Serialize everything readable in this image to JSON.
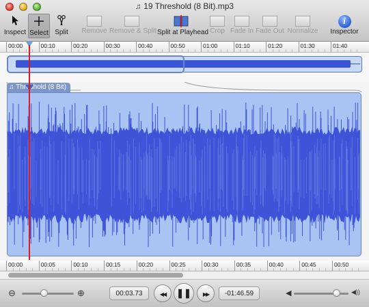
{
  "window": {
    "title": "19 Threshold (8 Bit).mp3",
    "doc_icon": "music-document-icon"
  },
  "toolbar": {
    "inspect": "Inspect",
    "select": "Select",
    "split": "Split",
    "remove": "Remove",
    "remove_split": "Remove & Split",
    "split_playhead": "Split at Playhead",
    "crop": "Crop",
    "fade_in": "Fade In",
    "fade_out": "Fade Out",
    "normalize": "Normalize",
    "inspector": "Inspector",
    "inspector_glyph": "i"
  },
  "overview_ruler": [
    "00:00",
    "00:10",
    "00:20",
    "00:30",
    "00:40",
    "00:50",
    "01:00",
    "01:10",
    "01:20",
    "01:30",
    "01:40"
  ],
  "track": {
    "name": "Threshold (8 Bit)",
    "music_glyph": "♫"
  },
  "detail_ruler": [
    "00:00",
    "00:05",
    "00:10",
    "00:15",
    "00:20",
    "00:25",
    "00:30",
    "00:35",
    "00:40",
    "00:45",
    "00:50"
  ],
  "transport": {
    "elapsed": "00:03.73",
    "remaining": "-01:46.59",
    "rewind_glyph": "◀◀",
    "play_glyph": "❚❚",
    "forward_glyph": "▶▶",
    "zoom_out_glyph": "⊖",
    "zoom_in_glyph": "⊕",
    "vol_low_glyph": "◀",
    "vol_high_glyph": "◀))",
    "zoom_level": 0.45,
    "volume_level": 0.82
  },
  "colors": {
    "waveform": "#3f53d8",
    "track_bg": "#a9c4f2",
    "playhead": "#e01a24"
  }
}
